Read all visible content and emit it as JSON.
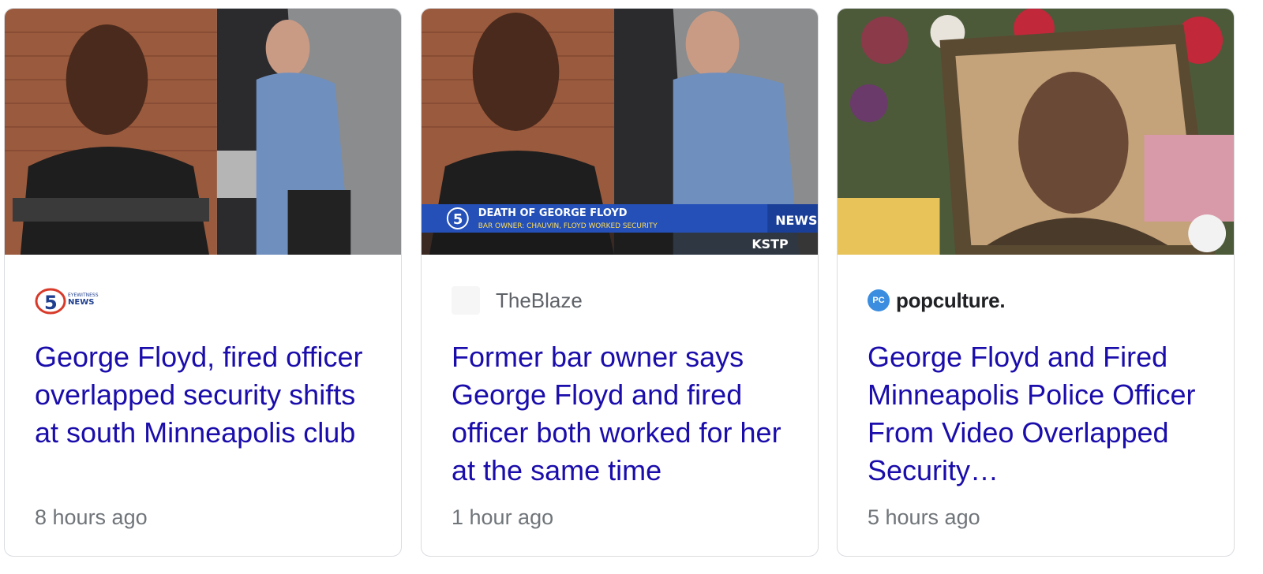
{
  "cards": [
    {
      "source": "",
      "headline": "George Floyd, fired officer overlapped security shifts at south Minneapolis club",
      "time": "8 hours ago"
    },
    {
      "source": "TheBlaze",
      "headline": "Former bar owner says George Floyd and fired officer both worked for her at the same time",
      "time": "1 hour ago",
      "banner_title": "DEATH OF GEORGE FLOYD",
      "banner_sub": "BAR OWNER: CHAUVIN, FLOYD WORKED SECURITY",
      "banner_news": "NEWS",
      "banner_station": "KSTP"
    },
    {
      "source": "popculture.",
      "source_badge": "PC",
      "headline": "George Floyd and Fired Minneapolis Police Officer From Video Overlapped Security…",
      "time": "5 hours ago"
    }
  ],
  "colors": {
    "headline": "#1a0dab",
    "meta": "#70757a",
    "border": "#dadce0"
  }
}
